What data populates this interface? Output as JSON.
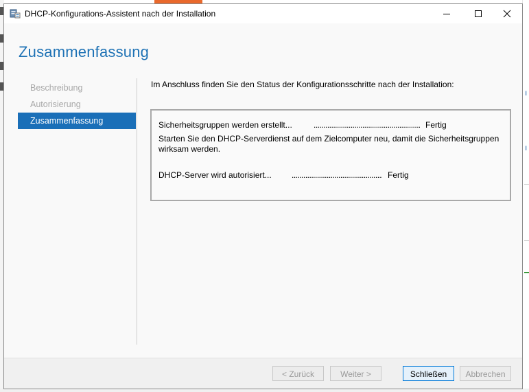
{
  "window": {
    "title": "DHCP-Konfigurations-Assistent nach der Installation",
    "controls": [
      "minimize-icon",
      "maximize-icon",
      "close-icon"
    ]
  },
  "heading": "Zusammenfassung",
  "nav": {
    "items": [
      {
        "label": "Beschreibung",
        "state": "disabled"
      },
      {
        "label": "Autorisierung",
        "state": "disabled"
      },
      {
        "label": "Zusammenfassung",
        "state": "active"
      }
    ]
  },
  "content": {
    "intro": "Im Anschluss finden Sie den Status der Konfigurationsschritte nach der Installation:",
    "steps": [
      {
        "label": "Sicherheitsgruppen werden erstellt...",
        "leader": "........................................................................",
        "status": "Fertig",
        "note": "Starten Sie den DHCP-Serverdienst auf dem Zielcomputer neu, damit die Sicherheitsgruppen wirksam werden."
      },
      {
        "label": "DHCP-Server wird autorisiert...",
        "leader": "..........................................................................",
        "status": "Fertig"
      }
    ]
  },
  "footer": {
    "back_label": "< Zurück",
    "next_label": "Weiter >",
    "close_label": "Schließen",
    "cancel_label": "Abbrechen"
  },
  "colors": {
    "accent": "#1a6fb8",
    "heading": "#1e72b5",
    "disabled_text": "#a8a8a8"
  }
}
